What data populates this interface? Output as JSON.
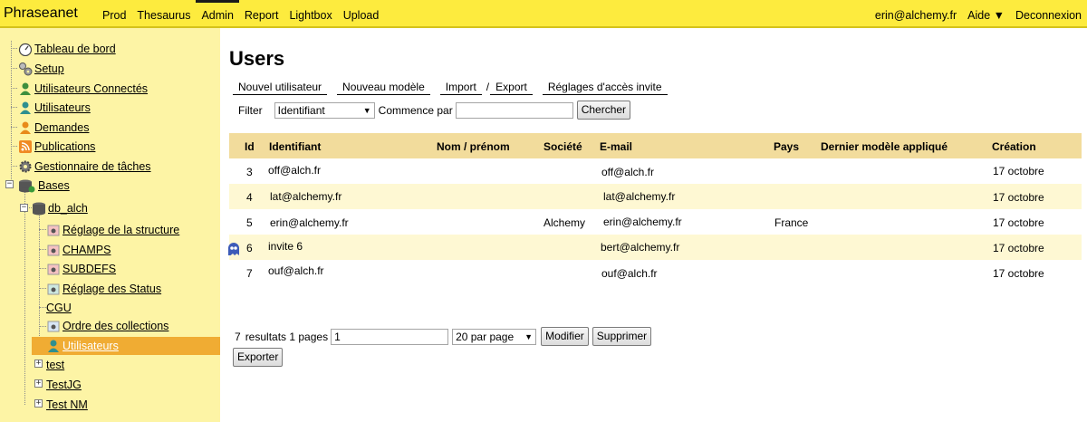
{
  "topbar": {
    "brand": "Phraseanet",
    "nav": [
      "Prod",
      "Thesaurus",
      "Admin",
      "Report",
      "Lightbox",
      "Upload"
    ],
    "active": "Admin",
    "user": "erin@alchemy.fr",
    "help": "Aide ▼",
    "logout": "Deconnexion"
  },
  "sidebar": {
    "items": [
      {
        "label": "Tableau de bord",
        "icon": "dashboard-icon"
      },
      {
        "label": "Setup",
        "icon": "setup-gears-icon"
      },
      {
        "label": "Utilisateurs Connectés",
        "icon": "connected-users-icon"
      },
      {
        "label": "Utilisateurs",
        "icon": "users-icon"
      },
      {
        "label": "Demandes",
        "icon": "requests-icon"
      },
      {
        "label": "Publications",
        "icon": "rss-icon"
      },
      {
        "label": "Gestionnaire de tâches",
        "icon": "gear-icon"
      },
      {
        "label": "Bases",
        "icon": "databases-icon"
      }
    ],
    "db": {
      "label": "db_alch",
      "children": [
        {
          "label": "Réglage de la structure",
          "icon": "structure-icon"
        },
        {
          "label": "CHAMPS",
          "icon": "fields-icon"
        },
        {
          "label": "SUBDEFS",
          "icon": "subdefs-icon"
        },
        {
          "label": "Réglage des Status",
          "icon": "status-icon"
        },
        {
          "label": "CGU",
          "icon": ""
        },
        {
          "label": "Ordre des collections",
          "icon": "collection-order-icon"
        },
        {
          "label": "Utilisateurs",
          "icon": "users-icon"
        }
      ]
    },
    "collections": [
      "test",
      "TestJG",
      "Test NM"
    ]
  },
  "main": {
    "title": "Users",
    "actions": [
      "Nouvel utilisateur",
      "Nouveau modèle",
      "Import",
      "/",
      "Export",
      "Réglages d'accès invite"
    ],
    "filter": {
      "label": "Filter",
      "field": "Identifiant",
      "mode_label": "Commence par",
      "value": "",
      "search_button": "Chercher"
    },
    "table": {
      "columns": [
        "Id",
        "Identifiant",
        "Nom / prénom",
        "Société",
        "E-mail",
        "Pays",
        "Dernier modèle appliqué",
        "Création"
      ],
      "rows": [
        {
          "id": "3",
          "login": "off@alch.fr",
          "name": "",
          "company": "",
          "email": "off@alch.fr",
          "country": "",
          "template": "",
          "created": "17 octobre",
          "guest": false
        },
        {
          "id": "4",
          "login": "lat@alchemy.fr",
          "name": "",
          "company": "",
          "email": "lat@alchemy.fr",
          "country": "",
          "template": "",
          "created": "17 octobre",
          "guest": false
        },
        {
          "id": "5",
          "login": "erin@alchemy.fr",
          "name": "",
          "company": "Alchemy",
          "email": "erin@alchemy.fr",
          "country": "France",
          "template": "",
          "created": "17 octobre",
          "guest": false
        },
        {
          "id": "6",
          "login": "invite 6",
          "name": "",
          "company": "",
          "email": "bert@alchemy.fr",
          "country": "",
          "template": "",
          "created": "17 octobre",
          "guest": true
        },
        {
          "id": "7",
          "login": "ouf@alch.fr",
          "name": "",
          "company": "",
          "email": "ouf@alch.fr",
          "country": "",
          "template": "",
          "created": "17 octobre",
          "guest": false
        }
      ]
    },
    "pager": {
      "count": "7",
      "results_label": "resultats 1 pages",
      "page_value": "1",
      "per_page": "20 par page",
      "modify_button": "Modifier",
      "delete_button": "Supprimer",
      "export_button": "Exporter"
    }
  },
  "colors": {
    "topbar": "#fdeb3e",
    "sidebar": "#fdf4a5",
    "selected": "#f0ac33",
    "table_header": "#f2dc9c",
    "row_alt": "#fef8d3"
  }
}
